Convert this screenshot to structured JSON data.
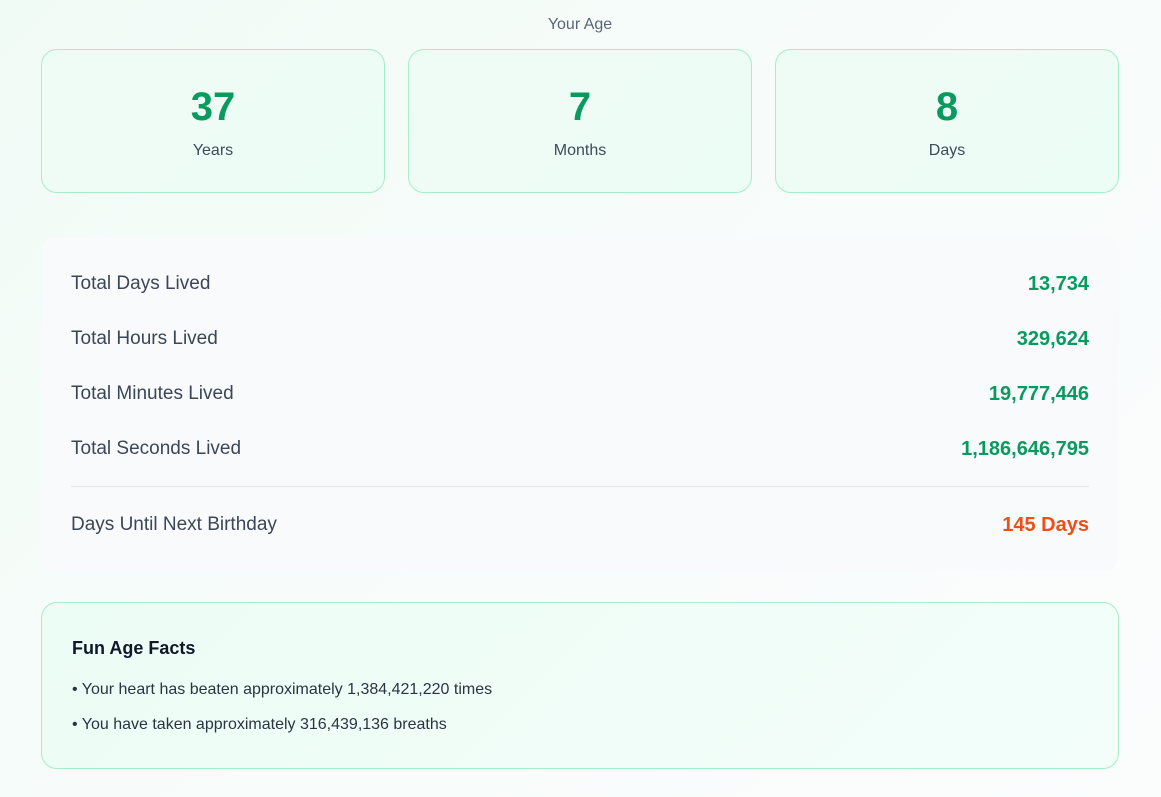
{
  "age": {
    "title": "Your Age",
    "cards": [
      {
        "value": "37",
        "label": "Years"
      },
      {
        "value": "7",
        "label": "Months"
      },
      {
        "value": "8",
        "label": "Days"
      }
    ]
  },
  "stats": {
    "rows": [
      {
        "label": "Total Days Lived",
        "value": "13,734"
      },
      {
        "label": "Total Hours Lived",
        "value": "329,624"
      },
      {
        "label": "Total Minutes Lived",
        "value": "19,777,446"
      },
      {
        "label": "Total Seconds Lived",
        "value": "1,186,646,795"
      }
    ],
    "birthday": {
      "label": "Days Until Next Birthday",
      "value": "145 Days"
    }
  },
  "facts": {
    "title": "Fun Age Facts",
    "items": [
      "• Your heart has beaten approximately 1,384,421,220 times",
      "• You have taken approximately 316,439,136 breaths"
    ]
  },
  "colors": {
    "accent_green": "#0a9a5f",
    "accent_orange": "#ef4e14",
    "card_border": "#a7eccb"
  }
}
